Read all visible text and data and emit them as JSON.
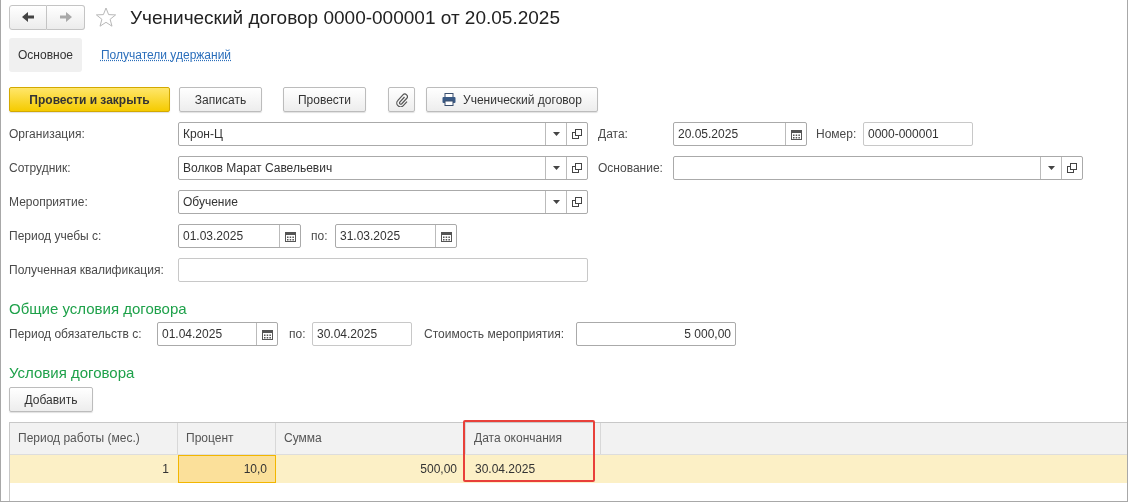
{
  "window": {
    "title": "Ученический договор 0000-000001 от 20.05.2025",
    "favorite": false
  },
  "nav": {
    "back_disabled": false,
    "forward_disabled": true
  },
  "tabs": [
    {
      "label": "Основное",
      "selected": true
    },
    {
      "label": "Получатели удержаний",
      "selected": false
    }
  ],
  "toolbar": [
    {
      "kind": "primary",
      "label": "Провести и закрыть"
    },
    {
      "kind": "plain",
      "label": "Записать"
    },
    {
      "kind": "plain",
      "label": "Провести"
    },
    {
      "kind": "attach"
    },
    {
      "kind": "print",
      "label": "Ученический договор"
    }
  ],
  "form": {
    "rows": [
      [
        {
          "label": "Организация:",
          "kind": "select",
          "value": "Крон-Ц"
        },
        {
          "label": "Дата:",
          "kind": "date",
          "value": "20.05.2025"
        },
        {
          "label": "Номер:",
          "kind": "text",
          "value": "0000-000001"
        }
      ],
      [
        {
          "label": "Сотрудник:",
          "kind": "select",
          "value": "Волков Марат Савельевич"
        },
        {
          "label": "Основание:",
          "kind": "select"
        }
      ],
      [
        {
          "label": "Мероприятие:",
          "kind": "select",
          "value": "Обучение"
        }
      ],
      [
        {
          "label": "Период учебы с:",
          "kind": "date",
          "value": "01.03.2025"
        },
        {
          "label": "по:",
          "kind": "date",
          "value": "31.03.2025"
        }
      ],
      [
        {
          "label": "Полученная квалификация:",
          "kind": "text"
        }
      ]
    ]
  },
  "general_terms": {
    "heading": "Общие условия договора",
    "fields": [
      {
        "label": "Период обязательств с:",
        "kind": "date",
        "value": "01.04.2025"
      },
      {
        "label": "по:",
        "kind": "text",
        "value": "30.04.2025"
      },
      {
        "label": "Стоимость мероприятия:",
        "kind": "number",
        "value": "5 000,00"
      }
    ]
  },
  "terms": {
    "heading": "Условия договора",
    "add_button": "Добавить",
    "table": {
      "columns": [
        {
          "title": "Период работы (мес.)",
          "kind": "number",
          "highlighted": false
        },
        {
          "title": "Процент",
          "kind": "number",
          "highlighted": false
        },
        {
          "title": "Сумма",
          "kind": "number",
          "highlighted": false
        },
        {
          "title": "Дата окончания",
          "kind": "date",
          "highlighted": true
        }
      ],
      "rows": [
        {
          "selected": true,
          "cells": [
            {
              "text": "1",
              "current": false
            },
            {
              "text": "10,0",
              "current": true
            },
            {
              "text": "500,00",
              "current": false
            },
            {
              "text": "30.04.2025",
              "current": false
            }
          ]
        }
      ]
    }
  }
}
